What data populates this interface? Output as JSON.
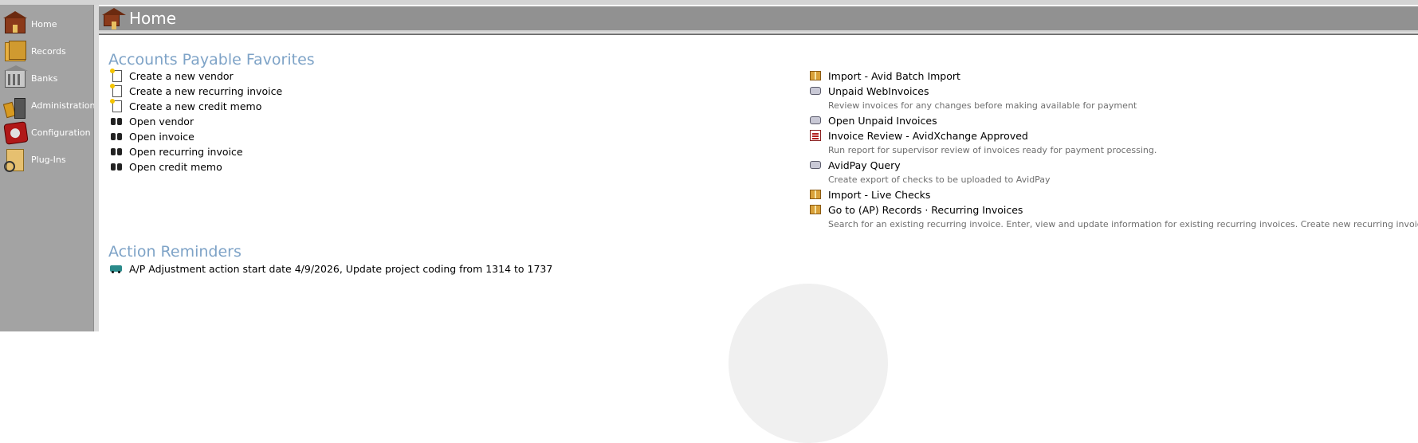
{
  "sidebar": {
    "items": [
      {
        "label": "Home",
        "icon": "home-icon"
      },
      {
        "label": "Records",
        "icon": "records-icon"
      },
      {
        "label": "Banks",
        "icon": "banks-icon"
      },
      {
        "label": "Administration",
        "icon": "administration-icon"
      },
      {
        "label": "Configuration",
        "icon": "configuration-icon"
      },
      {
        "label": "Plug-Ins",
        "icon": "plug-ins-icon"
      }
    ]
  },
  "header": {
    "title": "Home",
    "icon": "home-icon"
  },
  "favorites": {
    "title": "Accounts Payable Favorites",
    "left": [
      {
        "label": "Create a new vendor",
        "icon": "new-document-icon"
      },
      {
        "label": "Create a new recurring invoice",
        "icon": "new-document-icon"
      },
      {
        "label": "Create a new credit memo",
        "icon": "new-document-icon"
      },
      {
        "label": "Open vendor",
        "icon": "binoculars-icon"
      },
      {
        "label": "Open invoice",
        "icon": "binoculars-icon"
      },
      {
        "label": "Open recurring invoice",
        "icon": "binoculars-icon"
      },
      {
        "label": "Open credit memo",
        "icon": "binoculars-icon"
      }
    ],
    "right": [
      {
        "label": "Import - Avid Batch Import",
        "icon": "package-icon",
        "desc": ""
      },
      {
        "label": "Unpaid WebInvoices",
        "icon": "hand-document-icon",
        "desc": "Review invoices for any changes before making available for payment"
      },
      {
        "label": "Open Unpaid Invoices",
        "icon": "hand-document-icon",
        "desc": ""
      },
      {
        "label": "Invoice Review - AvidXchange Approved",
        "icon": "report-icon",
        "desc": "Run report for supervisor review of invoices ready for payment processing."
      },
      {
        "label": "AvidPay Query",
        "icon": "hand-document-icon",
        "desc": "Create export of checks to be uploaded to AvidPay"
      },
      {
        "label": "Import - Live Checks",
        "icon": "package-icon",
        "desc": ""
      },
      {
        "label": "Go to (AP) Records · Recurring Invoices",
        "icon": "package-icon",
        "desc": "Search for an existing recurring invoice. Enter, view and update information for existing recurring invoices. Create new recurring invoices."
      }
    ]
  },
  "reminders": {
    "title": "Action Reminders",
    "items": [
      {
        "label": "A/P Adjustment action start date 4/9/2026, Update project coding from 1314 to 1737",
        "icon": "truck-icon"
      }
    ]
  }
}
